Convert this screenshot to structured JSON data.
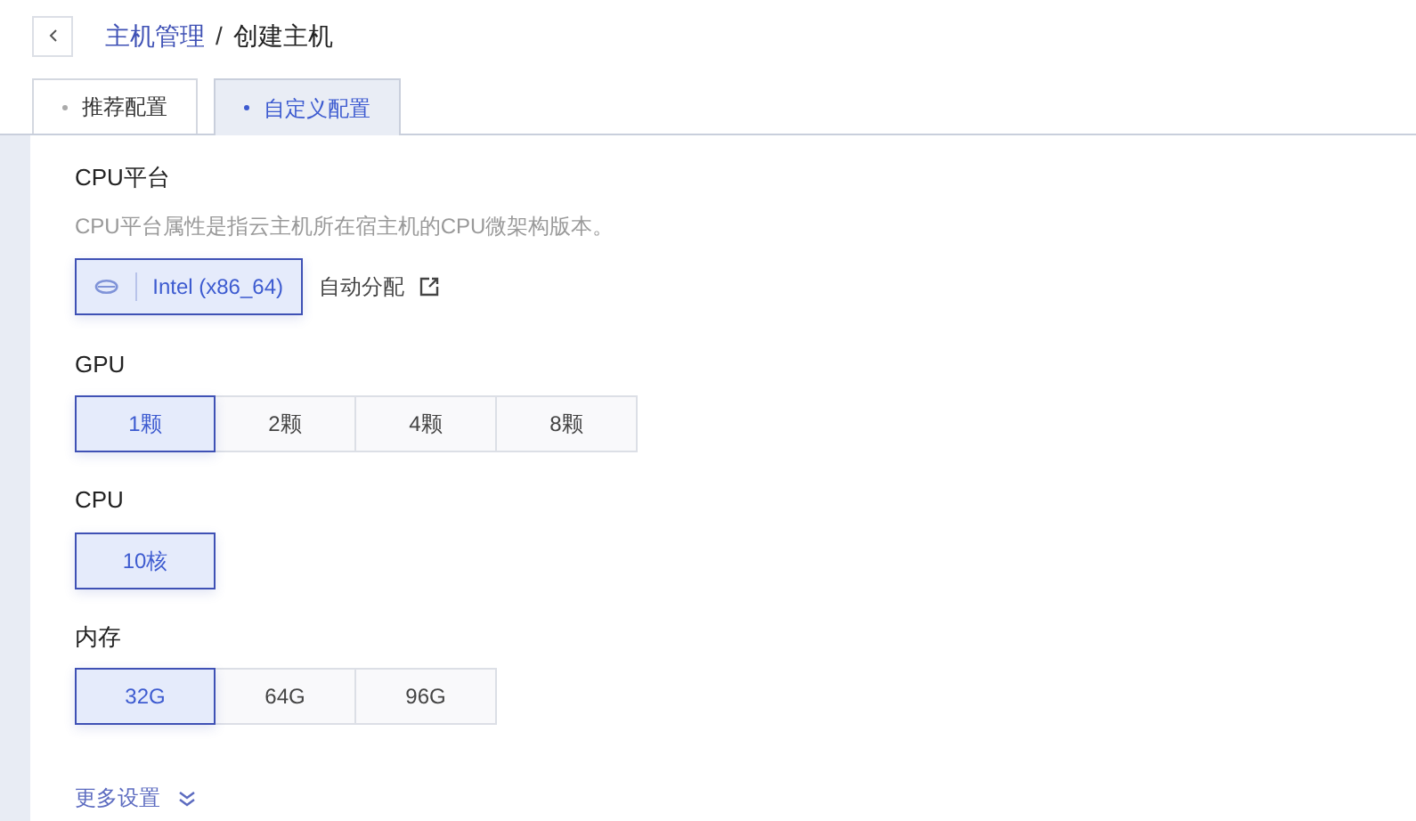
{
  "breadcrumb": {
    "parent": "主机管理",
    "separator": "/",
    "current": "创建主机"
  },
  "tabs": [
    {
      "label": "推荐配置",
      "selected": false
    },
    {
      "label": "自定义配置",
      "selected": true
    }
  ],
  "cpu_platform": {
    "title": "CPU平台",
    "description": "CPU平台属性是指云主机所在宿主机的CPU微架构版本。",
    "option": {
      "label": "Intel (x86_64)",
      "selected": true
    },
    "auto_label": "自动分配"
  },
  "groups": [
    {
      "title": "GPU",
      "options": [
        {
          "label": "1颗",
          "selected": true
        },
        {
          "label": "2颗",
          "selected": false
        },
        {
          "label": "4颗",
          "selected": false
        },
        {
          "label": "8颗",
          "selected": false
        }
      ]
    },
    {
      "title": "CPU",
      "options": [
        {
          "label": "10核",
          "selected": true
        }
      ]
    },
    {
      "title": "内存",
      "options": [
        {
          "label": "32G",
          "selected": true
        },
        {
          "label": "64G",
          "selected": false
        },
        {
          "label": "96G",
          "selected": false
        }
      ]
    }
  ],
  "more_settings": {
    "label": "更多设置",
    "expanded": false
  }
}
